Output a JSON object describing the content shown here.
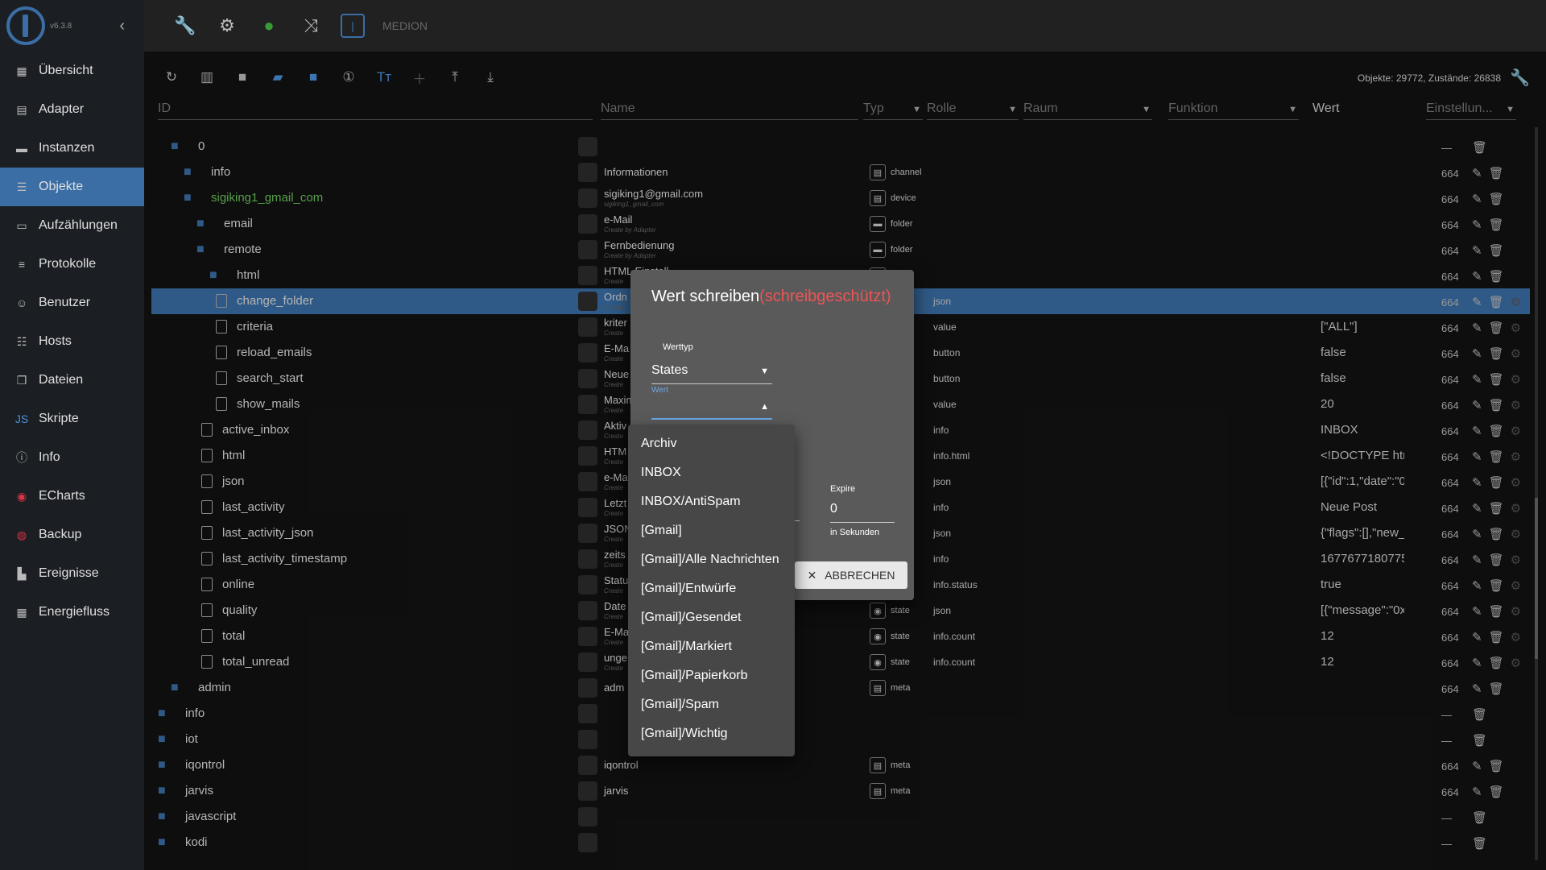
{
  "app": {
    "version": "v6.3.8",
    "host": "MEDION"
  },
  "sidebar": {
    "items": [
      {
        "label": "Übersicht",
        "icon": "grid-icon",
        "glyph": "▦"
      },
      {
        "label": "Adapter",
        "icon": "store-icon",
        "glyph": "▤"
      },
      {
        "label": "Instanzen",
        "icon": "instances-icon",
        "glyph": "▬"
      },
      {
        "label": "Objekte",
        "icon": "list-icon",
        "glyph": "☰"
      },
      {
        "label": "Aufzählungen",
        "icon": "enum-icon",
        "glyph": "▭"
      },
      {
        "label": "Protokolle",
        "icon": "log-icon",
        "glyph": "≡"
      },
      {
        "label": "Benutzer",
        "icon": "user-icon",
        "glyph": "☺"
      },
      {
        "label": "Hosts",
        "icon": "hosts-icon",
        "glyph": "☷"
      },
      {
        "label": "Dateien",
        "icon": "files-icon",
        "glyph": "❐"
      },
      {
        "label": "Skripte",
        "icon": "js-icon",
        "glyph": "JS"
      },
      {
        "label": "Info",
        "icon": "info-icon",
        "glyph": "ⓘ"
      },
      {
        "label": "ECharts",
        "icon": "echarts-icon",
        "glyph": "◉"
      },
      {
        "label": "Backup",
        "icon": "backup-icon",
        "glyph": "◍"
      },
      {
        "label": "Ereignisse",
        "icon": "events-icon",
        "glyph": "▙"
      },
      {
        "label": "Energiefluss",
        "icon": "energy-icon",
        "glyph": "▦"
      }
    ]
  },
  "toolbar": {
    "counts": "Objekte: 29772, Zustände: 26838"
  },
  "columns": {
    "id": "ID",
    "name": "Name",
    "typ": "Typ",
    "rolle": "Rolle",
    "raum": "Raum",
    "funktion": "Funktion",
    "wert": "Wert",
    "einstellungen": "Einstellun..."
  },
  "rows": [
    {
      "id": "0",
      "name": "",
      "sub": "",
      "typ": "",
      "rolle": "",
      "wert": "",
      "perm": "—"
    },
    {
      "id": "info",
      "name": "Informationen",
      "sub": "",
      "typ": "channel",
      "rolle": "",
      "wert": "",
      "perm": "664"
    },
    {
      "id": "sigiking1_gmail_com",
      "name": "sigiking1@gmail.com",
      "sub": "sigiking1_gmail_com",
      "typ": "device",
      "rolle": "",
      "wert": "",
      "perm": "664"
    },
    {
      "id": "email",
      "name": "e-Mail",
      "sub": "Create by Adapter",
      "typ": "folder",
      "rolle": "",
      "wert": "",
      "perm": "664"
    },
    {
      "id": "remote",
      "name": "Fernbedienung",
      "sub": "Create by Adapter",
      "typ": "folder",
      "rolle": "",
      "wert": "",
      "perm": "664"
    },
    {
      "id": "html",
      "name": "HTML Einstell",
      "sub": "Create",
      "typ": "er",
      "rolle": "",
      "wert": "",
      "perm": "664"
    },
    {
      "id": "change_folder",
      "name": "Ordn",
      "sub": "Create",
      "typ": "",
      "rolle": "json",
      "wert": "",
      "perm": "664"
    },
    {
      "id": "criteria",
      "name": "kriter",
      "sub": "Create",
      "typ": "",
      "rolle": "value",
      "wert": "[\"ALL\"]",
      "perm": "664"
    },
    {
      "id": "reload_emails",
      "name": "E-Ma",
      "sub": "Create",
      "typ": "",
      "rolle": "button",
      "wert": "false",
      "perm": "664"
    },
    {
      "id": "search_start",
      "name": "Neue",
      "sub": "Create",
      "typ": "",
      "rolle": "button",
      "wert": "false",
      "perm": "664"
    },
    {
      "id": "show_mails",
      "name": "Maxim",
      "sub": "Create",
      "typ": "",
      "rolle": "value",
      "wert": "20",
      "perm": "664"
    },
    {
      "id": "active_inbox",
      "name": "Aktiv",
      "sub": "Create",
      "typ": "",
      "rolle": "info",
      "wert": "INBOX",
      "perm": "664"
    },
    {
      "id": "html",
      "name": "HTM",
      "sub": "Create",
      "typ": "",
      "rolle": "info.html",
      "wert": "<!DOCTYPE html...",
      "perm": "664"
    },
    {
      "id": "json",
      "name": "e-Ma",
      "sub": "Create",
      "typ": "",
      "rolle": "json",
      "wert": "[{\"id\":1,\"date\":\"01...",
      "perm": "664"
    },
    {
      "id": "last_activity",
      "name": "Letzt",
      "sub": "Create",
      "typ": "",
      "rolle": "info",
      "wert": "Neue Post",
      "perm": "664"
    },
    {
      "id": "last_activity_json",
      "name": "JSON",
      "sub": "Create",
      "typ": "",
      "rolle": "json",
      "wert": "{\"flags\":[],\"new_m...",
      "perm": "664"
    },
    {
      "id": "last_activity_timestamp",
      "name": "zeits",
      "sub": "Create",
      "typ": "",
      "rolle": "info",
      "wert": "1677677180775",
      "perm": "664"
    },
    {
      "id": "online",
      "name": "Statu",
      "sub": "Create",
      "typ": "",
      "rolle": "info.status",
      "wert": "true",
      "perm": "664"
    },
    {
      "id": "quality",
      "name": "Date",
      "sub": "Create",
      "typ": "state",
      "rolle": "json",
      "wert": "[{\"message\":\"0x20...",
      "perm": "664"
    },
    {
      "id": "total",
      "name": "E-Ma",
      "sub": "Create",
      "typ": "state",
      "rolle": "info.count",
      "wert": "12",
      "perm": "664"
    },
    {
      "id": "total_unread",
      "name": "unge",
      "sub": "Create",
      "typ": "state",
      "rolle": "info.count",
      "wert": "12",
      "perm": "664"
    },
    {
      "id": "admin",
      "name": "adm",
      "sub": "",
      "typ": "meta",
      "rolle": "",
      "wert": "",
      "perm": "664"
    },
    {
      "id": "info",
      "name": "",
      "sub": "",
      "typ": "",
      "rolle": "",
      "wert": "",
      "perm": "—"
    },
    {
      "id": "iot",
      "name": "",
      "sub": "",
      "typ": "",
      "rolle": "",
      "wert": "",
      "perm": "—"
    },
    {
      "id": "iqontrol",
      "name": "iqontrol",
      "sub": "",
      "typ": "meta",
      "rolle": "",
      "wert": "",
      "perm": "664"
    },
    {
      "id": "jarvis",
      "name": "jarvis",
      "sub": "",
      "typ": "meta",
      "rolle": "",
      "wert": "",
      "perm": "664"
    },
    {
      "id": "javascript",
      "name": "",
      "sub": "",
      "typ": "",
      "rolle": "",
      "wert": "",
      "perm": "—"
    },
    {
      "id": "kodi",
      "name": "",
      "sub": "",
      "typ": "",
      "rolle": "",
      "wert": "",
      "perm": "—"
    }
  ],
  "dialog": {
    "title": "Wert schreiben",
    "readonly": "(schreibgeschützt)",
    "werttyp_label": "Werttyp",
    "werttyp_value": "States",
    "wert_label": "Wert",
    "expire_label": "Expire",
    "expire_value": "0",
    "expire_hint": "in Sekunden",
    "cancel": "ABBRECHEN"
  },
  "dropdown": {
    "options": [
      "Archiv",
      "INBOX",
      "INBOX/AntiSpam",
      "[Gmail]",
      "[Gmail]/Alle Nachrichten",
      "[Gmail]/Entwürfe",
      "[Gmail]/Gesendet",
      "[Gmail]/Markiert",
      "[Gmail]/Papierkorb",
      "[Gmail]/Spam",
      "[Gmail]/Wichtig"
    ]
  }
}
